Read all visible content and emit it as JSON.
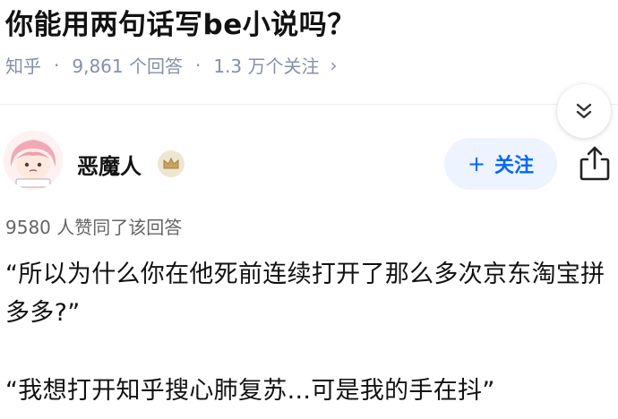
{
  "question": {
    "title": "你能用两句话写be小说吗？"
  },
  "meta": {
    "source": "知乎",
    "separator": "·",
    "answers": "9,861 个回答",
    "followers": "1.3 万个关注",
    "chevron": "›"
  },
  "icons": {
    "collapse": "double-chevron-down-icon",
    "share": "share-icon",
    "badge": "crown-badge-icon"
  },
  "author": {
    "name": "恶魔人",
    "follow_plus": "+",
    "follow_label": "关注"
  },
  "answer": {
    "votes": "9580 人赞同了该回答",
    "paragraphs": [
      "“所以为什么你在他死前连续打开了那么多次京东淘宝拼多多?”",
      "“我想打开知乎搜心肺复苏...可是我的手在抖”"
    ]
  },
  "colors": {
    "accent": "#0066ff",
    "follow_bg": "#eef4ff",
    "meta": "#8590a6"
  }
}
